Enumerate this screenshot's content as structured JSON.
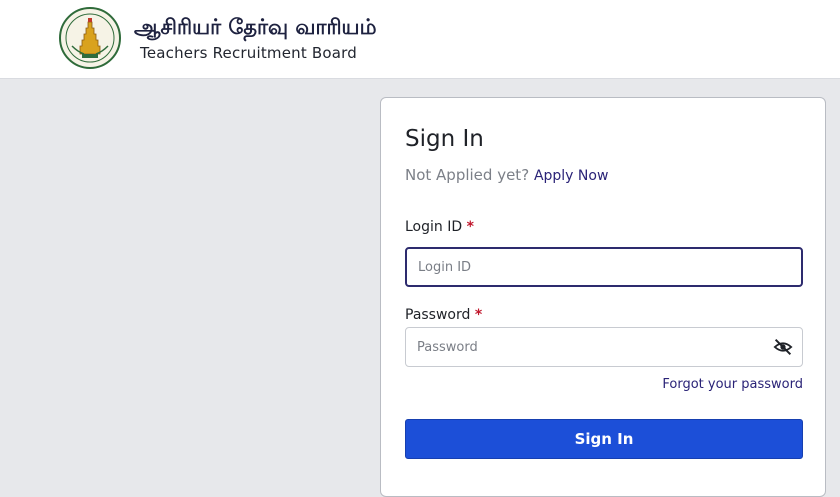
{
  "header": {
    "title_tamil": "ஆசிரியர் தேர்வு வாரியம்",
    "title_english": "Teachers Recruitment Board",
    "logo_icon": "tamil-nadu-emblem-icon"
  },
  "signin": {
    "title": "Sign In",
    "not_applied_text": "Not Applied yet?",
    "apply_link": "Apply Now",
    "login_id_label": "Login ID",
    "login_id_placeholder": "Login ID",
    "password_label": "Password",
    "password_placeholder": "Password",
    "required_mark": "*",
    "password_toggle_icon": "eye-slash-icon",
    "forgot_link": "Forgot your password",
    "submit_label": "Sign In"
  },
  "colors": {
    "accent_button": "#1c4fd8",
    "link": "#2a2377",
    "required": "#c0162b",
    "background": "#e7e8eb"
  }
}
